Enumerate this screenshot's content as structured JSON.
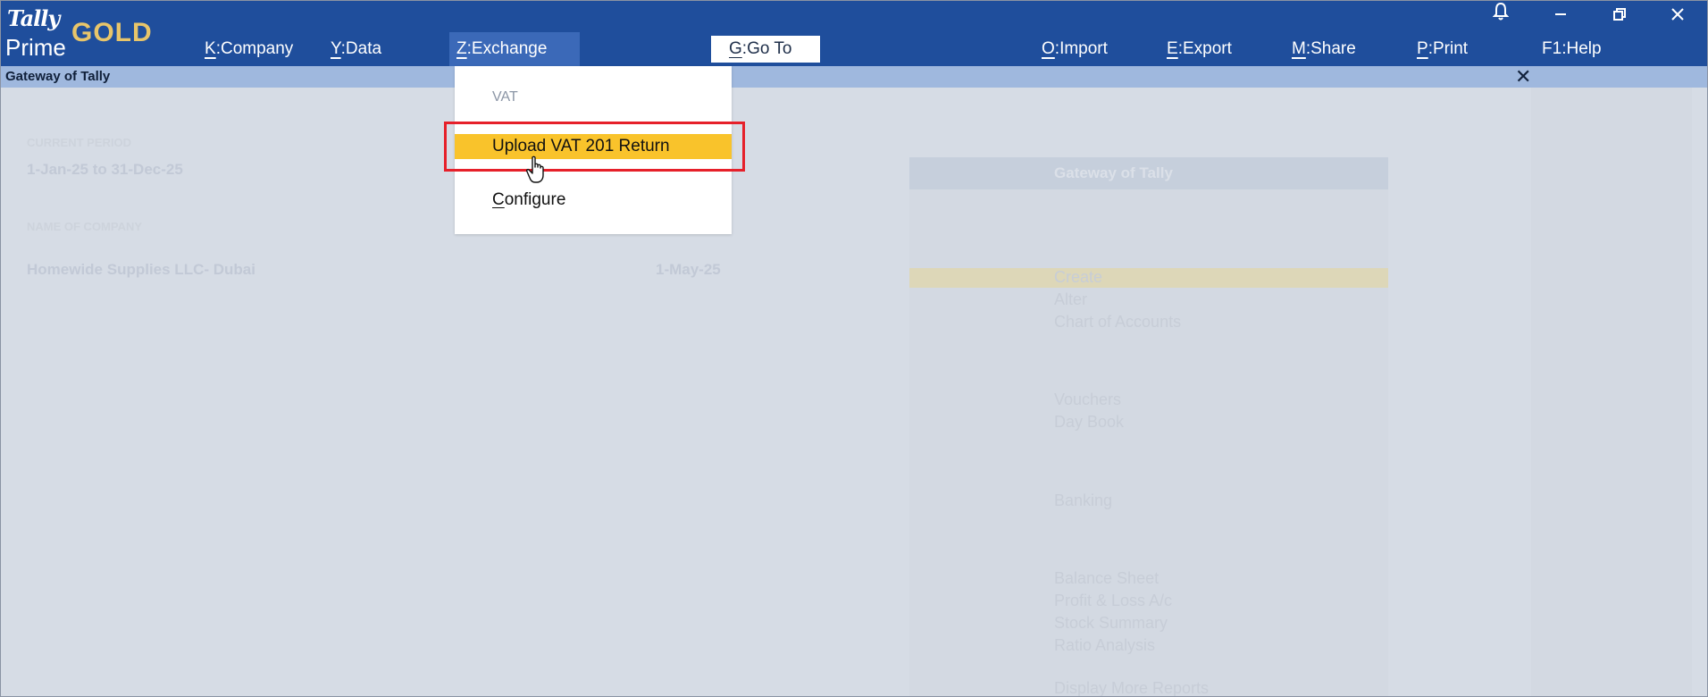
{
  "app": {
    "logo_tally": "Tally",
    "logo_prime": "Prime",
    "logo_gold": "GOLD"
  },
  "menu": {
    "company": {
      "key": "K",
      "label": "Company"
    },
    "data": {
      "key": "Y",
      "label": "Data"
    },
    "exchange": {
      "key": "Z",
      "label": "Exchange"
    },
    "goto": {
      "key": "G",
      "label": "Go To"
    },
    "import": {
      "key": "O",
      "label": "Import"
    },
    "export": {
      "key": "E",
      "label": "Export"
    },
    "share": {
      "key": "M",
      "label": "Share"
    },
    "print": {
      "key": "P",
      "label": "Print"
    },
    "help": {
      "key": "F1",
      "label": "Help"
    }
  },
  "window_icons": [
    "bell-icon",
    "minimize-icon",
    "restore-icon",
    "close-icon"
  ],
  "subbar": {
    "title": "Gateway of Tally"
  },
  "dropdown": {
    "header": "VAT",
    "items": [
      {
        "label": "Upload VAT 201 Return",
        "selected": true
      },
      {
        "key": "C",
        "rest": "onfigure",
        "label": "Configure",
        "selected": false
      }
    ]
  },
  "background": {
    "current_period_label": "CURRENT PERIOD",
    "period": "1-Jan-25 to 31-Dec-25",
    "current_company_label": "NAME OF COMPANY",
    "company_name": "Homewide Supplies LLC- Dubai",
    "company_date": "1-May-25",
    "gateway_title": "Gateway of Tally",
    "gateway_items": [
      "Create",
      "Alter",
      "Chart of Accounts",
      "Vouchers",
      "Day Book",
      "Banking",
      "Balance Sheet",
      "Profit & Loss A/c",
      "Stock Summary",
      "Ratio Analysis",
      "Display More Reports"
    ]
  },
  "colors": {
    "topbar": "#1f4e9c",
    "selected_item": "#f9c32b",
    "highlight_box": "#e6202a"
  }
}
